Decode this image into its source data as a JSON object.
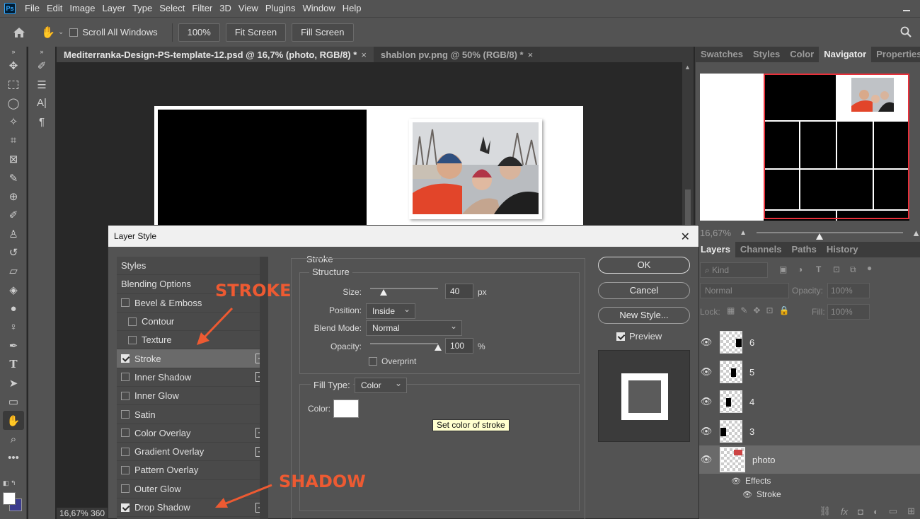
{
  "menubar": {
    "logo": "Ps",
    "items": [
      "File",
      "Edit",
      "Image",
      "Layer",
      "Type",
      "Select",
      "Filter",
      "3D",
      "View",
      "Plugins",
      "Window",
      "Help"
    ]
  },
  "optionsbar": {
    "scroll_all_label": "Scroll All Windows",
    "zoom_btn": "100%",
    "fit_btn": "Fit Screen",
    "fill_btn": "Fill Screen"
  },
  "doc_tabs": [
    {
      "label": "Mediterranka-Design-PS-template-12.psd @ 16,7% (photo, RGB/8) *",
      "close": "×"
    },
    {
      "label": "shablon pv.png @ 50% (RGB/8) *",
      "close": "×"
    }
  ],
  "status": {
    "zoom": "16,67%",
    "extra": "360"
  },
  "panels": {
    "top_tabs": [
      "Swatches",
      "Styles",
      "Color",
      "Navigator",
      "Properties"
    ],
    "active_top_tab": "Navigator",
    "nav_zoom": "16,67%",
    "nav_zoom_level": 0.43,
    "layer_tabs": [
      "Layers",
      "Channels",
      "Paths",
      "History"
    ],
    "kind_label": "Kind",
    "blend_mode": "Normal",
    "opacity_label": "Opacity:",
    "opacity_value": "100%",
    "lock_label": "Lock:",
    "fill_label": "Fill:",
    "fill_value": "100%",
    "layers": [
      {
        "name": "6"
      },
      {
        "name": "5"
      },
      {
        "name": "4"
      },
      {
        "name": "3"
      },
      {
        "name": "photo"
      }
    ],
    "effects_label": "Effects",
    "stroke_effect_label": "Stroke"
  },
  "dialog": {
    "title": "Layer Style",
    "close": "✕",
    "styles_header": "Styles",
    "blending_options": "Blending Options",
    "items": [
      {
        "label": "Bevel & Emboss",
        "checked": false,
        "plus": false,
        "indent": false
      },
      {
        "label": "Contour",
        "checked": false,
        "plus": false,
        "indent": true
      },
      {
        "label": "Texture",
        "checked": false,
        "plus": false,
        "indent": true
      },
      {
        "label": "Stroke",
        "checked": true,
        "plus": true,
        "indent": false,
        "selected": true
      },
      {
        "label": "Inner Shadow",
        "checked": false,
        "plus": true,
        "indent": false
      },
      {
        "label": "Inner Glow",
        "checked": false,
        "plus": false,
        "indent": false
      },
      {
        "label": "Satin",
        "checked": false,
        "plus": false,
        "indent": false
      },
      {
        "label": "Color Overlay",
        "checked": false,
        "plus": true,
        "indent": false
      },
      {
        "label": "Gradient Overlay",
        "checked": false,
        "plus": true,
        "indent": false
      },
      {
        "label": "Pattern Overlay",
        "checked": false,
        "plus": false,
        "indent": false
      },
      {
        "label": "Outer Glow",
        "checked": false,
        "plus": false,
        "indent": false
      },
      {
        "label": "Drop Shadow",
        "checked": true,
        "plus": true,
        "indent": false
      }
    ],
    "stroke": {
      "section": "Stroke",
      "structure": "Structure",
      "size_label": "Size:",
      "size_value": "40",
      "size_unit": "px",
      "size_level": 0.2,
      "position_label": "Position:",
      "position_value": "Inside",
      "blend_label": "Blend Mode:",
      "blend_value": "Normal",
      "opacity_label": "Opacity:",
      "opacity_value": "100",
      "opacity_unit": "%",
      "opacity_level": 1.0,
      "overprint_label": "Overprint",
      "fill_type_label": "Fill Type:",
      "fill_type_value": "Color",
      "color_label": "Color:",
      "tooltip": "Set color of stroke"
    },
    "buttons": {
      "ok": "OK",
      "cancel": "Cancel",
      "new_style": "New Style...",
      "preview": "Preview"
    }
  },
  "annotations": {
    "stroke": "STROKE",
    "shadow": "SHADOW",
    "color": "#ed5a32"
  }
}
